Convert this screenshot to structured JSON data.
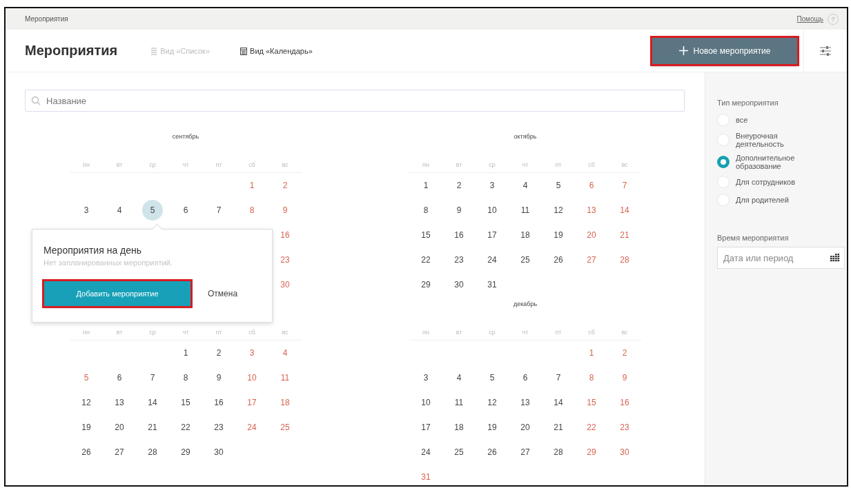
{
  "breadcrumb": "Мероприятия",
  "help": {
    "label": "Помощь",
    "badge": "?"
  },
  "header": {
    "title": "Мероприятия",
    "tabs": [
      {
        "label": "Вид «Список»",
        "selected": false
      },
      {
        "label": "Вид «Календарь»",
        "selected": true
      }
    ],
    "new_button": {
      "label": "Новое мероприятие",
      "highlighted": true
    }
  },
  "search": {
    "placeholder": "Название"
  },
  "months": [
    {
      "title": "сентябрь",
      "weekdays": [
        "пн",
        "вт",
        "ср",
        "чт",
        "пт",
        "сб",
        "вс"
      ],
      "weeks": [
        [
          {
            "kind": "blank"
          },
          {
            "kind": "blank"
          },
          {
            "kind": "blank"
          },
          {
            "kind": "blank"
          },
          {
            "kind": "blank"
          },
          {
            "kind": "day",
            "day": "1",
            "holiday": true,
            "selected": false
          },
          {
            "kind": "day",
            "day": "2",
            "holiday": true,
            "selected": false
          }
        ],
        [
          {
            "kind": "day",
            "day": "3",
            "holiday": false,
            "selected": false
          },
          {
            "kind": "day",
            "day": "4",
            "holiday": false,
            "selected": false
          },
          {
            "kind": "day",
            "day": "5",
            "holiday": false,
            "selected": true
          },
          {
            "kind": "day",
            "day": "6",
            "holiday": false,
            "selected": false
          },
          {
            "kind": "day",
            "day": "7",
            "holiday": false,
            "selected": false
          },
          {
            "kind": "day",
            "day": "8",
            "holiday": true,
            "selected": false
          },
          {
            "kind": "day",
            "day": "9",
            "holiday": true,
            "selected": false
          }
        ],
        [
          {
            "kind": "blank"
          },
          {
            "kind": "blank"
          },
          {
            "kind": "blank"
          },
          {
            "kind": "blank"
          },
          {
            "kind": "blank"
          },
          {
            "kind": "blank"
          },
          {
            "kind": "day",
            "day": "16",
            "holiday": true,
            "selected": false
          }
        ],
        [
          {
            "kind": "blank"
          },
          {
            "kind": "blank"
          },
          {
            "kind": "blank"
          },
          {
            "kind": "blank"
          },
          {
            "kind": "blank"
          },
          {
            "kind": "blank"
          },
          {
            "kind": "day",
            "day": "23",
            "holiday": true,
            "selected": false
          }
        ],
        [
          {
            "kind": "blank"
          },
          {
            "kind": "blank"
          },
          {
            "kind": "blank"
          },
          {
            "kind": "blank"
          },
          {
            "kind": "blank"
          },
          {
            "kind": "blank"
          },
          {
            "kind": "day",
            "day": "30",
            "holiday": true,
            "selected": false
          }
        ]
      ]
    },
    {
      "weekdays": [
        "пн",
        "вт",
        "ср",
        "чт",
        "пт",
        "сб",
        "вс"
      ],
      "weeks": [
        [
          {
            "kind": "blank"
          },
          {
            "kind": "blank"
          },
          {
            "kind": "blank"
          },
          {
            "kind": "day",
            "day": "1",
            "holiday": false,
            "selected": false
          },
          {
            "kind": "day",
            "day": "2",
            "holiday": false,
            "selected": false
          },
          {
            "kind": "day",
            "day": "3",
            "holiday": true,
            "selected": false
          },
          {
            "kind": "day",
            "day": "4",
            "holiday": true,
            "selected": false
          }
        ],
        [
          {
            "kind": "day",
            "day": "5",
            "holiday": true,
            "selected": false
          },
          {
            "kind": "day",
            "day": "6",
            "holiday": false,
            "selected": false
          },
          {
            "kind": "day",
            "day": "7",
            "holiday": false,
            "selected": false
          },
          {
            "kind": "day",
            "day": "8",
            "holiday": false,
            "selected": false
          },
          {
            "kind": "day",
            "day": "9",
            "holiday": false,
            "selected": false
          },
          {
            "kind": "day",
            "day": "10",
            "holiday": true,
            "selected": false
          },
          {
            "kind": "day",
            "day": "11",
            "holiday": true,
            "selected": false
          }
        ],
        [
          {
            "kind": "day",
            "day": "12",
            "holiday": false,
            "selected": false
          },
          {
            "kind": "day",
            "day": "13",
            "holiday": false,
            "selected": false
          },
          {
            "kind": "day",
            "day": "14",
            "holiday": false,
            "selected": false
          },
          {
            "kind": "day",
            "day": "15",
            "holiday": false,
            "selected": false
          },
          {
            "kind": "day",
            "day": "16",
            "holiday": false,
            "selected": false
          },
          {
            "kind": "day",
            "day": "17",
            "holiday": true,
            "selected": false
          },
          {
            "kind": "day",
            "day": "18",
            "holiday": true,
            "selected": false
          }
        ],
        [
          {
            "kind": "day",
            "day": "19",
            "holiday": false,
            "selected": false
          },
          {
            "kind": "day",
            "day": "20",
            "holiday": false,
            "selected": false
          },
          {
            "kind": "day",
            "day": "21",
            "holiday": false,
            "selected": false
          },
          {
            "kind": "day",
            "day": "22",
            "holiday": false,
            "selected": false
          },
          {
            "kind": "day",
            "day": "23",
            "holiday": false,
            "selected": false
          },
          {
            "kind": "day",
            "day": "24",
            "holiday": true,
            "selected": false
          },
          {
            "kind": "day",
            "day": "25",
            "holiday": true,
            "selected": false
          }
        ],
        [
          {
            "kind": "day",
            "day": "26",
            "holiday": false,
            "selected": false
          },
          {
            "kind": "day",
            "day": "27",
            "holiday": false,
            "selected": false
          },
          {
            "kind": "day",
            "day": "28",
            "holiday": false,
            "selected": false
          },
          {
            "kind": "day",
            "day": "29",
            "holiday": false,
            "selected": false
          },
          {
            "kind": "day",
            "day": "30",
            "holiday": false,
            "selected": false
          }
        ]
      ]
    },
    {
      "title": "октябрь",
      "weekdays": [
        "пн",
        "вт",
        "ср",
        "чт",
        "пт",
        "сб",
        "вс"
      ],
      "weeks": [
        [
          {
            "kind": "day",
            "day": "1",
            "holiday": false,
            "selected": false
          },
          {
            "kind": "day",
            "day": "2",
            "holiday": false,
            "selected": false
          },
          {
            "kind": "day",
            "day": "3",
            "holiday": false,
            "selected": false
          },
          {
            "kind": "day",
            "day": "4",
            "holiday": false,
            "selected": false
          },
          {
            "kind": "day",
            "day": "5",
            "holiday": false,
            "selected": false
          },
          {
            "kind": "day",
            "day": "6",
            "holiday": true,
            "selected": false
          },
          {
            "kind": "day",
            "day": "7",
            "holiday": true,
            "selected": false
          }
        ],
        [
          {
            "kind": "day",
            "day": "8",
            "holiday": false,
            "selected": false
          },
          {
            "kind": "day",
            "day": "9",
            "holiday": false,
            "selected": false
          },
          {
            "kind": "day",
            "day": "10",
            "holiday": false,
            "selected": false
          },
          {
            "kind": "day",
            "day": "11",
            "holiday": false,
            "selected": false
          },
          {
            "kind": "day",
            "day": "12",
            "holiday": false,
            "selected": false
          },
          {
            "kind": "day",
            "day": "13",
            "holiday": true,
            "selected": false
          },
          {
            "kind": "day",
            "day": "14",
            "holiday": true,
            "selected": false
          }
        ],
        [
          {
            "kind": "day",
            "day": "15",
            "holiday": false,
            "selected": false
          },
          {
            "kind": "day",
            "day": "16",
            "holiday": false,
            "selected": false
          },
          {
            "kind": "day",
            "day": "17",
            "holiday": false,
            "selected": false
          },
          {
            "kind": "day",
            "day": "18",
            "holiday": false,
            "selected": false
          },
          {
            "kind": "day",
            "day": "19",
            "holiday": false,
            "selected": false
          },
          {
            "kind": "day",
            "day": "20",
            "holiday": true,
            "selected": false
          },
          {
            "kind": "day",
            "day": "21",
            "holiday": true,
            "selected": false
          }
        ],
        [
          {
            "kind": "day",
            "day": "22",
            "holiday": false,
            "selected": false
          },
          {
            "kind": "day",
            "day": "23",
            "holiday": false,
            "selected": false
          },
          {
            "kind": "day",
            "day": "24",
            "holiday": false,
            "selected": false
          },
          {
            "kind": "day",
            "day": "25",
            "holiday": false,
            "selected": false
          },
          {
            "kind": "day",
            "day": "26",
            "holiday": false,
            "selected": false
          },
          {
            "kind": "day",
            "day": "27",
            "holiday": true,
            "selected": false
          },
          {
            "kind": "day",
            "day": "28",
            "holiday": true,
            "selected": false
          }
        ],
        [
          {
            "kind": "day",
            "day": "29",
            "holiday": false,
            "selected": false
          },
          {
            "kind": "day",
            "day": "30",
            "holiday": false,
            "selected": false
          },
          {
            "kind": "day",
            "day": "31",
            "holiday": false,
            "selected": false
          }
        ]
      ]
    },
    {
      "title": "декабрь",
      "weekdays": [
        "пн",
        "вт",
        "ср",
        "чт",
        "пт",
        "сб",
        "вс"
      ],
      "weeks": [
        [
          {
            "kind": "blank"
          },
          {
            "kind": "blank"
          },
          {
            "kind": "blank"
          },
          {
            "kind": "blank"
          },
          {
            "kind": "blank"
          },
          {
            "kind": "day",
            "day": "1",
            "holiday": true,
            "selected": false
          },
          {
            "kind": "day",
            "day": "2",
            "holiday": true,
            "selected": false
          }
        ],
        [
          {
            "kind": "day",
            "day": "3",
            "holiday": false,
            "selected": false
          },
          {
            "kind": "day",
            "day": "4",
            "holiday": false,
            "selected": false
          },
          {
            "kind": "day",
            "day": "5",
            "holiday": false,
            "selected": false
          },
          {
            "kind": "day",
            "day": "6",
            "holiday": false,
            "selected": false
          },
          {
            "kind": "day",
            "day": "7",
            "holiday": false,
            "selected": false
          },
          {
            "kind": "day",
            "day": "8",
            "holiday": true,
            "selected": false
          },
          {
            "kind": "day",
            "day": "9",
            "holiday": true,
            "selected": false
          }
        ],
        [
          {
            "kind": "day",
            "day": "10",
            "holiday": false,
            "selected": false
          },
          {
            "kind": "day",
            "day": "11",
            "holiday": false,
            "selected": false
          },
          {
            "kind": "day",
            "day": "12",
            "holiday": false,
            "selected": false
          },
          {
            "kind": "day",
            "day": "13",
            "holiday": false,
            "selected": false
          },
          {
            "kind": "day",
            "day": "14",
            "holiday": false,
            "selected": false
          },
          {
            "kind": "day",
            "day": "15",
            "holiday": true,
            "selected": false
          },
          {
            "kind": "day",
            "day": "16",
            "holiday": true,
            "selected": false
          }
        ],
        [
          {
            "kind": "day",
            "day": "17",
            "holiday": false,
            "selected": false
          },
          {
            "kind": "day",
            "day": "18",
            "holiday": false,
            "selected": false
          },
          {
            "kind": "day",
            "day": "19",
            "holiday": false,
            "selected": false
          },
          {
            "kind": "day",
            "day": "20",
            "holiday": false,
            "selected": false
          },
          {
            "kind": "day",
            "day": "21",
            "holiday": false,
            "selected": false
          },
          {
            "kind": "day",
            "day": "22",
            "holiday": true,
            "selected": false
          },
          {
            "kind": "day",
            "day": "23",
            "holiday": true,
            "selected": false
          }
        ],
        [
          {
            "kind": "day",
            "day": "24",
            "holiday": false,
            "selected": false
          },
          {
            "kind": "day",
            "day": "25",
            "holiday": false,
            "selected": false
          },
          {
            "kind": "day",
            "day": "26",
            "holiday": false,
            "selected": false
          },
          {
            "kind": "day",
            "day": "27",
            "holiday": false,
            "selected": false
          },
          {
            "kind": "day",
            "day": "28",
            "holiday": false,
            "selected": false
          },
          {
            "kind": "day",
            "day": "29",
            "holiday": true,
            "selected": false
          },
          {
            "kind": "day",
            "day": "30",
            "holiday": true,
            "selected": false
          }
        ],
        [
          {
            "kind": "day",
            "day": "31",
            "holiday": true,
            "selected": false
          }
        ]
      ]
    }
  ],
  "day_popup": {
    "title": "Мероприятия на день",
    "message": "Нет запланированных мероприятий.",
    "add_button": {
      "label": "Добавить мероприятие",
      "highlighted": true
    },
    "cancel_label": "Отмена"
  },
  "filters": {
    "type_title": "Тип мероприятия",
    "types": [
      {
        "label": "все",
        "selected": false
      },
      {
        "label": "Внеурочная деятельность",
        "selected": false
      },
      {
        "label": "Дополнительное образование",
        "selected": true
      },
      {
        "label": "Для сотрудников",
        "selected": false
      },
      {
        "label": "Для родителей",
        "selected": false
      }
    ],
    "time_title": "Время мероприятия",
    "date_placeholder": "Дата или период"
  }
}
